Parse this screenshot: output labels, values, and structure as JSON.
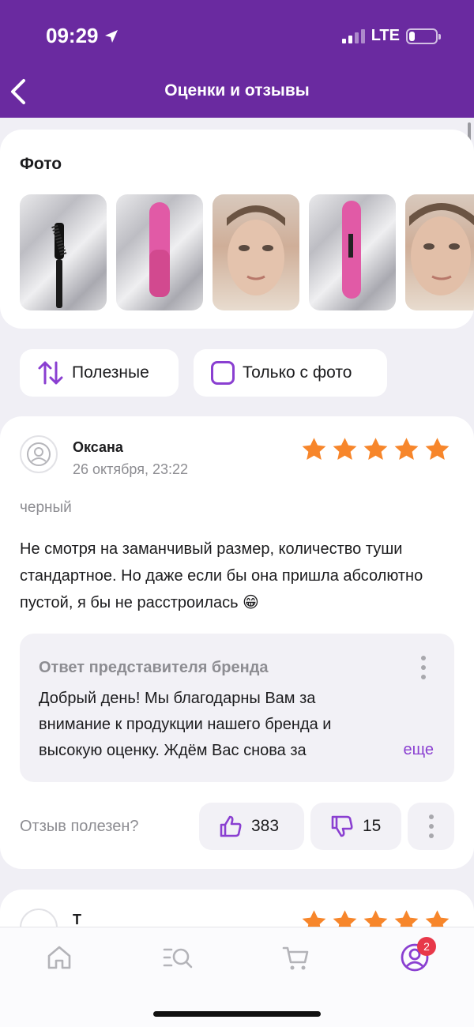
{
  "status_bar": {
    "time": "09:29",
    "network": "LTE"
  },
  "header": {
    "title": "Оценки и отзывы"
  },
  "photos": {
    "heading": "Фото"
  },
  "filters": {
    "sort_label": "Полезные",
    "photo_only_label": "Только с фото"
  },
  "review": {
    "author": "Оксана",
    "date": "26 октября, 23:22",
    "rating": 5,
    "variant": "черный",
    "text": "Не смотря на заманчивый размер, количество туши стандартное. Но даже если бы она пришла абсолютно пустой, я бы не расстроилась 😁",
    "reply": {
      "title": "Ответ представителя бренда",
      "text": "Добрый день!  Мы благодарны Вам за внимание к продукции нашего бренда и высокую оценку. Ждём Вас снова за",
      "more": "еще"
    },
    "useful_question": "Отзыв полезен?",
    "likes": "383",
    "dislikes": "15"
  },
  "review2": {
    "author": "Т",
    "rating": 5
  },
  "tabbar": {
    "profile_badge": "2"
  },
  "colors": {
    "accent": "#6a2aa0",
    "purple_icon": "#8a3fd1",
    "star": "#f7862b",
    "badge": "#e8384a"
  }
}
